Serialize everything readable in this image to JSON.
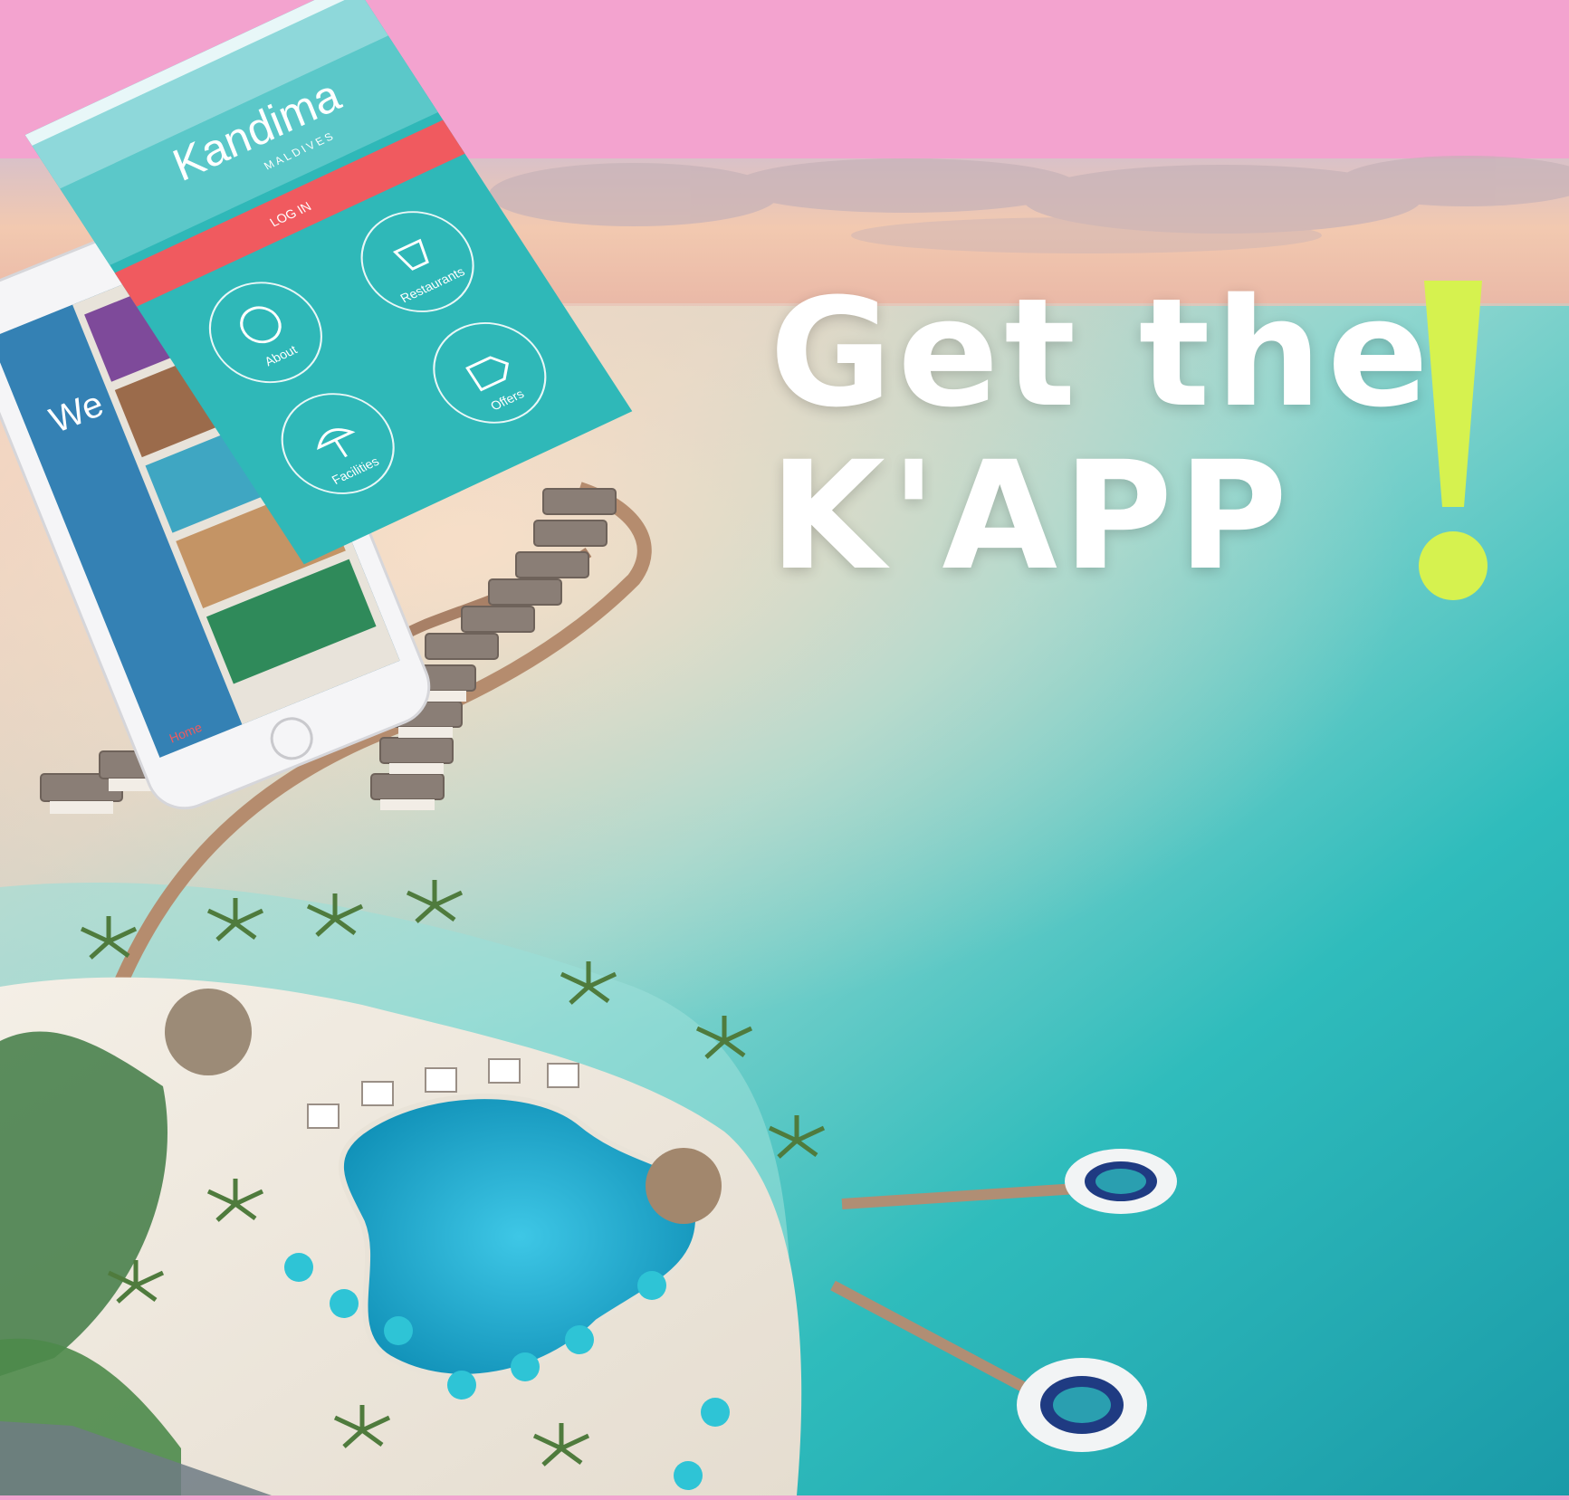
{
  "headline": {
    "line1": "Get the",
    "line2": "K'APP",
    "exclamation": "!"
  },
  "app": {
    "brand": "Kandima",
    "brand_sub": "MALDIVES",
    "login_label": "LOG IN",
    "menu": [
      {
        "label": "About",
        "icon": "kandima-k-icon"
      },
      {
        "label": "Restaurants",
        "icon": "chef-icon"
      },
      {
        "label": "Facilities",
        "icon": "beach-umbrella-icon"
      },
      {
        "label": "Offers",
        "icon": "tag-icon"
      }
    ],
    "back_screen_label": "Home",
    "back_screen_text": "We"
  },
  "colors": {
    "pink_band": "#f3a3cf",
    "teal": "#2fb8b8",
    "login_red": "#f05a5f",
    "exclamation": "#d6f24f"
  }
}
